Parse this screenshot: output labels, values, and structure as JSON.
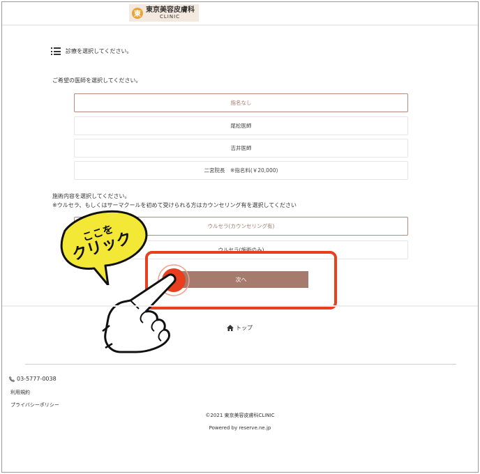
{
  "header": {
    "logo_jp": "東京美容皮膚科",
    "logo_en": "CLINIC",
    "logo_mark": "東"
  },
  "section_heading": "診療を選択してください。",
  "doctor_prompt": "ご希望の医師を選択してください。",
  "doctors": [
    {
      "label": "指名なし",
      "selected": true
    },
    {
      "label": "尾松医師",
      "selected": false
    },
    {
      "label": "吉井医師",
      "selected": false
    },
    {
      "label": "二宮院長　※指名料(￥20,000)",
      "selected": false
    }
  ],
  "treatment_prompt_line1": "施術内容を選択してください。",
  "treatment_prompt_line2": "※ウルセラ、もしくはサーマクールを初めて受けられる方はカウンセリング有を選択してください",
  "treatments": [
    {
      "label": "ウルセラ(カウンセリング有)",
      "selected": true
    },
    {
      "label": "ウルセラ(施術のみ)",
      "selected": false
    }
  ],
  "next_button": "次へ",
  "callout": {
    "line1": "ここを",
    "line2": "クリック"
  },
  "footer": {
    "top_link": "トップ",
    "phone": "03-5777-0038",
    "terms": "利用規約",
    "privacy": "プライバシーポリシー",
    "copyright": "©2021 東京美容皮膚科CLINIC",
    "powered": "Powered by reserve.ne.jp"
  },
  "colors": {
    "accent": "#a47b6c",
    "highlight": "#e8401f",
    "callout_yellow": "#f3e836",
    "tap_red": "#e8401f"
  },
  "icons": [
    "list-icon",
    "home-icon",
    "phone-icon",
    "pointing-hand-icon"
  ]
}
